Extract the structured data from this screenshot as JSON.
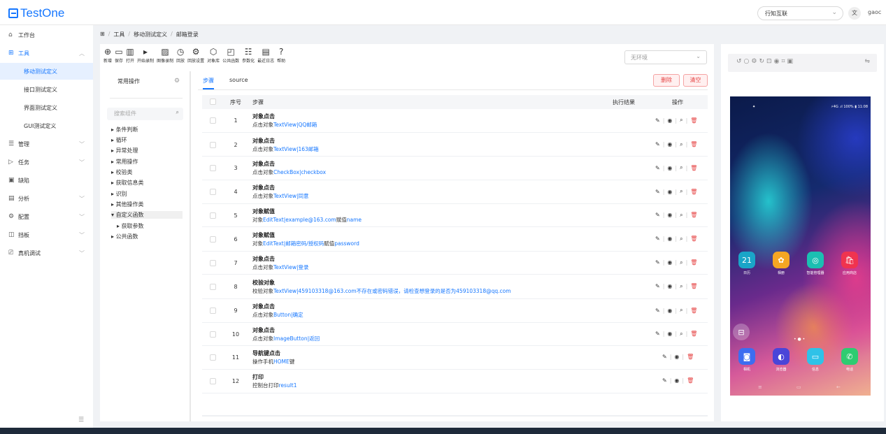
{
  "app": {
    "name": "TestOne",
    "org_select": "行知互联",
    "lang_icon": "translate-icon",
    "user": "gaoc"
  },
  "sidebar": {
    "items": [
      {
        "label": "工作台",
        "icon": "home-icon"
      },
      {
        "label": "工具",
        "icon": "grid-icon"
      },
      {
        "label": "管理",
        "icon": "list-icon"
      },
      {
        "label": "任务",
        "icon": "send-icon"
      },
      {
        "label": "缺陷",
        "icon": "bug-icon"
      },
      {
        "label": "分析",
        "icon": "calendar-icon"
      },
      {
        "label": "配置",
        "icon": "gear-icon"
      },
      {
        "label": "挡板",
        "icon": "panel-icon"
      },
      {
        "label": "真机调试",
        "icon": "device-icon"
      }
    ],
    "tools_sub": [
      "移动测试定义",
      "接口测试定义",
      "界面测试定义",
      "GUI测试定义"
    ]
  },
  "breadcrumb": [
    "工具",
    "移动测试定义",
    "邮箱登录"
  ],
  "toolbar": [
    {
      "label": "新增",
      "icon": "plus-circle-icon"
    },
    {
      "label": "保存",
      "icon": "save-icon"
    },
    {
      "label": "打开",
      "icon": "open-icon"
    },
    {
      "label": "开始录制",
      "icon": "record-icon"
    },
    {
      "label": "图像录制",
      "icon": "image-icon"
    },
    {
      "label": "回放",
      "icon": "replay-icon"
    },
    {
      "label": "回放设置",
      "icon": "settings-icon"
    },
    {
      "label": "对象库",
      "icon": "cube-icon"
    },
    {
      "label": "公共函数",
      "icon": "function-icon"
    },
    {
      "label": "参数化",
      "icon": "params-icon"
    },
    {
      "label": "最近日志",
      "icon": "log-icon"
    },
    {
      "label": "帮助",
      "icon": "help-icon"
    }
  ],
  "env_select": "无环境",
  "components": {
    "title": "常用操作",
    "search_placeholder": "搜索组件",
    "tree": [
      "条件判断",
      "循环",
      "异常处理",
      "常用操作",
      "校验类",
      "获取信息类",
      "识别",
      "其他操作类",
      "自定义函数",
      "获取参数",
      "公共函数"
    ]
  },
  "tabs": [
    "步骤",
    "source"
  ],
  "buttons": {
    "delete": "删除",
    "clear": "清空"
  },
  "table": {
    "headers": {
      "num": "序号",
      "step": "步骤",
      "result": "执行结果",
      "ops": "操作"
    },
    "rows": [
      {
        "num": "1",
        "title": "对象点击",
        "pre": "点击对象",
        "link": "TextView|QQ邮箱",
        "post": ""
      },
      {
        "num": "2",
        "title": "对象点击",
        "pre": "点击对象",
        "link": "TextView|163邮箱",
        "post": ""
      },
      {
        "num": "3",
        "title": "对象点击",
        "pre": "点击对象",
        "link": "CheckBox|checkbox",
        "post": ""
      },
      {
        "num": "4",
        "title": "对象点击",
        "pre": "点击对象",
        "link": "TextView|同意",
        "post": ""
      },
      {
        "num": "5",
        "title": "对象赋值",
        "pre": "对象",
        "link": "EditText|example@163.com",
        "post": "赋值",
        "link2": "name"
      },
      {
        "num": "6",
        "title": "对象赋值",
        "pre": "对象",
        "link": "EditText|邮箱密码/授权码",
        "post": "赋值",
        "link2": "password"
      },
      {
        "num": "7",
        "title": "对象点击",
        "pre": "点击对象",
        "link": "TextView|登录",
        "post": ""
      },
      {
        "num": "8",
        "title": "校验对象",
        "pre": "校验对象",
        "link": "TextView|459103318@163.com不存在或密码错误，请检查想登录的是否为459103318@qq.com",
        "post": ""
      },
      {
        "num": "9",
        "title": "对象点击",
        "pre": "点击对象",
        "link": "Button|确定",
        "post": ""
      },
      {
        "num": "10",
        "title": "对象点击",
        "pre": "点击对象",
        "link": "ImageButton|返回",
        "post": ""
      },
      {
        "num": "11",
        "title": "导航键点击",
        "pre": "操作手机",
        "link": "HOME",
        "post": "键"
      },
      {
        "num": "12",
        "title": "打印",
        "pre": "控制台打印",
        "link": "result1",
        "post": ""
      }
    ]
  },
  "phone": {
    "status_left": "⁕",
    "status_right": "⚡4G .ıl 100% ▮ 11:08",
    "apps_row1": [
      {
        "label": "日历",
        "glyph": "21",
        "color": "#1aa5c8"
      },
      {
        "label": "相册",
        "glyph": "✿",
        "color": "#f5a623"
      },
      {
        "label": "智能管理器",
        "glyph": "◎",
        "color": "#1bbfb2"
      },
      {
        "label": "应用商店",
        "glyph": "🛍",
        "color": "#f0334f"
      }
    ],
    "apps_row2": [
      {
        "label": "相机",
        "glyph": "◙",
        "color": "#3d6df0"
      },
      {
        "label": "浏览器",
        "glyph": "◐",
        "color": "#4a45d8"
      },
      {
        "label": "信息",
        "glyph": "▭",
        "color": "#2fc2e8"
      },
      {
        "label": "电话",
        "glyph": "✆",
        "color": "#2ecc71"
      }
    ]
  }
}
